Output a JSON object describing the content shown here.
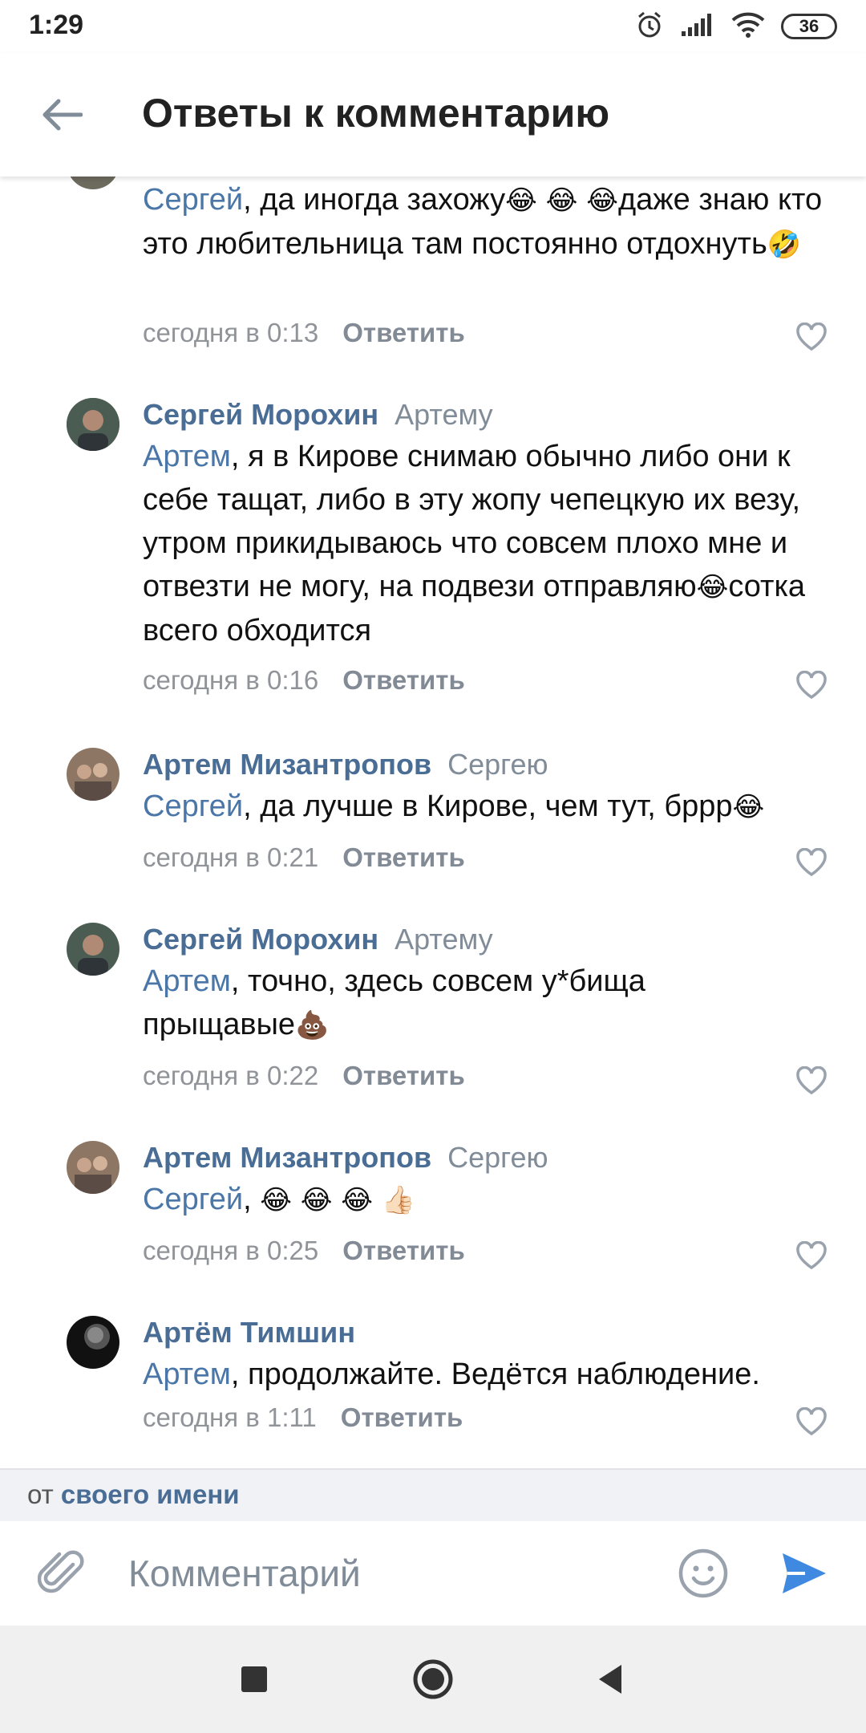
{
  "status_bar": {
    "time": "1:29",
    "battery": "36"
  },
  "header": {
    "title": "Ответы к комментарию"
  },
  "comments": [
    {
      "mention": "Сергей",
      "text_before_emoji": ", да иногда захожу",
      "emoji_1": "😂 😂 😂",
      "text_after_emoji": "даже знаю кто это любительница там постоянно отдохнуть",
      "emoji_2": "🤣",
      "time": "сегодня в 0:13",
      "reply_label": "Ответить"
    },
    {
      "author": "Сергей Морохин",
      "reply_to": "Артему",
      "mention": "Артем",
      "text_before_emoji": ", я в Кирове снимаю обычно либо они к себе тащат, либо в эту жопу чепецкую их везу, утром прикидываюсь что совсем плохо мне и отвезти не могу, на подвези отправляю",
      "emoji_1": "😂",
      "text_after_emoji": "сотка всего обходится",
      "time": "сегодня в 0:16",
      "reply_label": "Ответить"
    },
    {
      "author": "Артем Мизантропов",
      "reply_to": "Сергею",
      "mention": "Сергей",
      "text_before_emoji": ", да лучше в Кирове, чем тут, бррр",
      "emoji_1": "😂",
      "time": "сегодня в 0:21",
      "reply_label": "Ответить"
    },
    {
      "author": "Сергей Морохин",
      "reply_to": "Артему",
      "mention": "Артем",
      "text_before_emoji": ", точно, здесь совсем у*бища прыщавые",
      "emoji_1": "💩",
      "time": "сегодня в 0:22",
      "reply_label": "Ответить"
    },
    {
      "author": "Артем Мизантропов",
      "reply_to": "Сергею",
      "mention": "Сергей",
      "text_before_emoji": ", ",
      "emoji_1": "😂 😂 😂 👍🏻",
      "time": "сегодня в 0:25",
      "reply_label": "Ответить"
    },
    {
      "author": "Артём Тимшин",
      "mention": "Артем",
      "text_before_emoji": ", продолжайте. Ведётся наблюдение.",
      "time": "сегодня в 1:11",
      "reply_label": "Ответить"
    }
  ],
  "footer": {
    "from_prefix": "от",
    "from_link": "своего имени",
    "input_placeholder": "Комментарий"
  },
  "colors": {
    "link": "#4a6d95",
    "mention": "#4a76a8",
    "meta": "#909499",
    "send": "#3f8ae0"
  }
}
